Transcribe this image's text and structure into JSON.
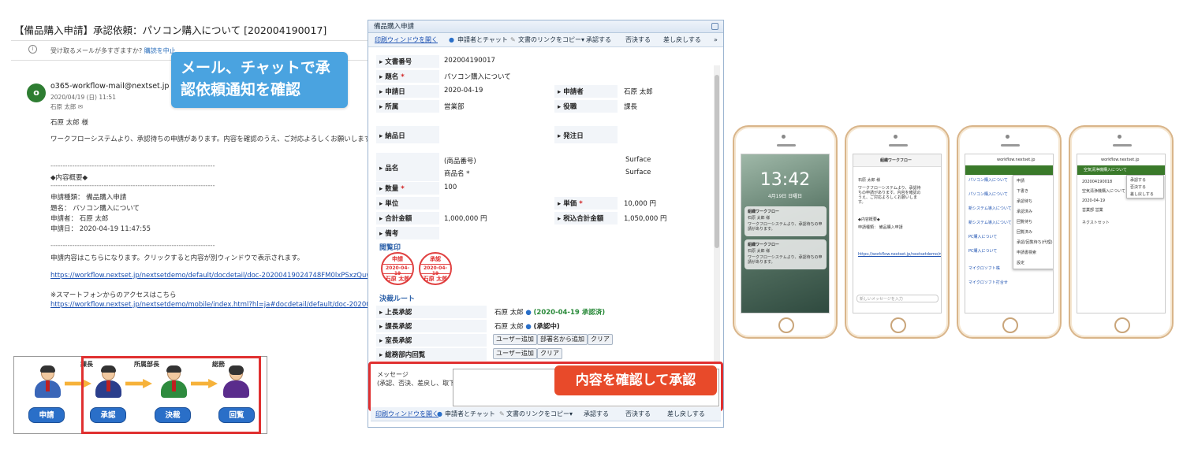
{
  "email": {
    "subject": "【備品購入申請】承認依頼：パソコン購入について [202004190017]",
    "notice_text": "受け取るメールが多すぎますか?",
    "notice_link": "購読を中止",
    "avatar_letter": "o",
    "sender": "o365-workflow-mail@nextset.jp",
    "date": "2020/04/19 (日) 11:51",
    "to": "石原 太郎 ✉",
    "greeting": "石原 太郎 様",
    "body1": "ワークフローシステムより、承認待ちの申請があります。内容を確認のうえ、ご対応よろしくお願いします。",
    "divider": "--------------------------------------------------------------------",
    "summary_title": "◆内容概要◆",
    "type_line": "申請種類： 備品購入申請",
    "title_line": "題名： パソコン購入について",
    "applicant_line": "申請者： 石原 太郎",
    "date_line": "申請日： 2020-04-19 11:47:55",
    "link_note": "申請内容はこちらになります。クリックすると内容が別ウィンドウで表示されます。",
    "link1": "https://workflow.nextset.jp/nextsetdemo/default/docdetail/doc-20200419024748FM0lxPSxzQuw",
    "mobile_note": "※スマートフォンからのアクセスはこちら",
    "link2": "https://workflow.nextset.jp/nextsetdemo/mobile/index.html?hl=ja#docdetail/default/doc-202004"
  },
  "callout_mail": "メール、チャットで承認依頼通知を確認",
  "flow": {
    "role_labels": [
      "課長",
      "所属部長",
      "総務"
    ],
    "buttons": [
      "申請",
      "承認",
      "決裁",
      "回覧"
    ]
  },
  "form": {
    "title": "備品購入申請",
    "toolbar": {
      "print": "印刷ウィンドウを開く",
      "chat": "申請者とチャット",
      "copy_link": "文書のリンクをコピー▾",
      "approve": "承認する",
      "reject": "否決する",
      "return": "差し戻しする",
      "more": "»"
    },
    "fields": {
      "doc_no_label": "文書番号",
      "doc_no": "202004190017",
      "title_label": "題名",
      "title_value": "パソコン購入について",
      "date_label": "申請日",
      "date_value": "2020-04-19",
      "applicant_label": "申請者",
      "applicant_value": "石原 太郎",
      "dept_label": "所属",
      "dept_value": "営業部",
      "position_label": "役職",
      "position_value": "課長",
      "delivery_label": "納品日",
      "order_label": "発注日",
      "item_label": "品名",
      "item_no": "(商品番号)",
      "item_name": "商品名 *",
      "item_no_value": "Surface",
      "item_name_value": "Surface",
      "qty_label": "数量",
      "qty_value": "100",
      "unit_label": "単位",
      "unit_price_label": "単価",
      "unit_price_value": "10,000 円",
      "total_label": "合計金額",
      "total_value": "1,000,000 円",
      "tax_total_label": "税込合計金額",
      "tax_total_value": "1,050,000 円",
      "note_label": "備考",
      "required_mark": "*"
    },
    "stamp_section": "閲覧印",
    "stamps": [
      {
        "top": "申請",
        "date": "2020-04-19",
        "name": "石原 太郎"
      },
      {
        "top": "承認",
        "date": "2020-04-19",
        "name": "石原 太郎"
      }
    ],
    "route_section": "決裁ルート",
    "route": [
      {
        "label": "上長承認",
        "value": "石原 太郎",
        "status": "(2020-04-19 承認済)"
      },
      {
        "label": "課長承認",
        "value": "石原 太郎",
        "status": "(承認中)"
      },
      {
        "label": "室長承認",
        "buttons": [
          "ユーザー追加",
          "部署名から追加",
          "クリア"
        ]
      },
      {
        "label": "総務部内回覧",
        "buttons": [
          "ユーザー追加",
          "クリア"
        ]
      }
    ],
    "message_label": "メッセージ\n(承認、否決、差戻し、取下げ理由)",
    "bottom_toolbar": {
      "print": "印刷ウィンドウを開く",
      "chat": "申請者とチャット",
      "copy_link": "文書のリンクをコピー▾",
      "approve": "承認する",
      "reject": "否決する",
      "return": "差し戻しする"
    }
  },
  "callout_form": "内容を確認して承認",
  "phones": {
    "p1": {
      "time": "13:42",
      "date": "4月19日 日曜日",
      "notif_title": "組織ワークフロー",
      "notif_text": "石原 太郎 様",
      "notif_body": "ワークフローシステムより、承認待ちの申請があります。"
    },
    "p2": {
      "header": "組織ワークフロー",
      "greeting": "石原 太郎 様",
      "text": "ワークフローシステムより、承認待ちの申請があります。内容を確認のうえ、ご対応よろしくお願いします。",
      "summary": "◆内容概要◆",
      "type": "申請種類： 備品購入申請",
      "link": "https://workflow.nextset.jp/nextsetdemo/mobile/",
      "input": "新しいメッセージを入力"
    },
    "p3": {
      "url": "workflow.nextset.jp",
      "menu": [
        "申請",
        "下書き",
        "承認待ち",
        "承認済み",
        "回覧待ち",
        "回覧済み",
        "承認/回覧待ち(代理)",
        "申請書検索",
        "設定"
      ],
      "list": [
        "パソコン購入について",
        "パソコン購入について",
        "新システム導入について",
        "新システム導入について",
        "PC購入について",
        "PC購入について",
        "マイクロソフト株",
        "マイクロソフト打合せ"
      ]
    },
    "p4": {
      "url": "workflow.nextset.jp",
      "header": "空気清浄機購入について",
      "actions": [
        "承認する",
        "否決する",
        "差し戻しする"
      ],
      "doc_no": "202004190018",
      "item": "空気清浄機購入について",
      "date": "2020-04-19",
      "dept": "営業部 営業",
      "note": "ネクストセット"
    }
  }
}
